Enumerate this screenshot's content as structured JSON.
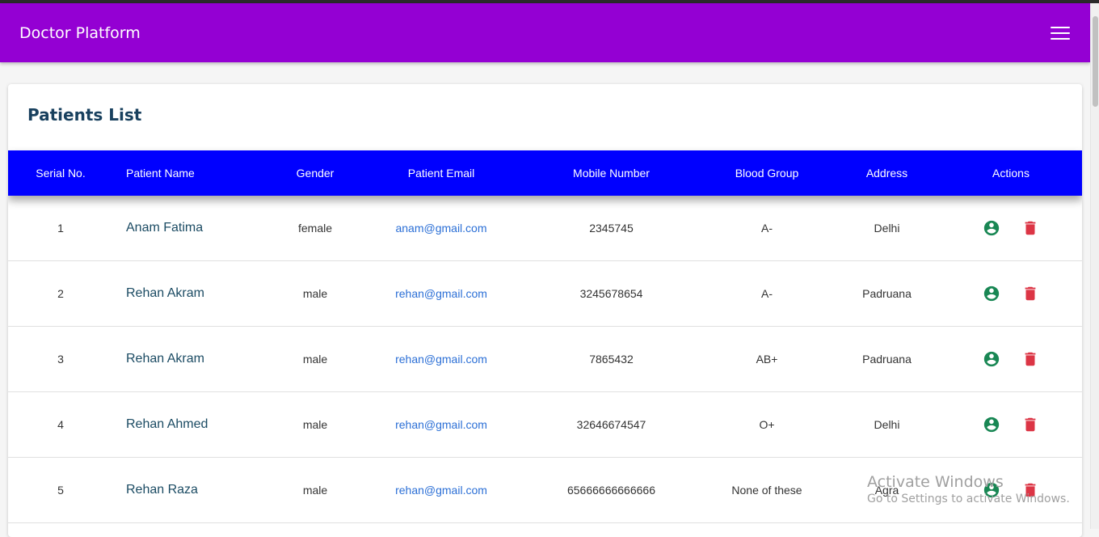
{
  "app": {
    "title": "Doctor Platform",
    "menu_icon": "menu-icon"
  },
  "page": {
    "title": "Patients List"
  },
  "table": {
    "headers": [
      "Serial No.",
      "Patient Name",
      "Gender",
      "Patient Email",
      "Mobile Number",
      "Blood Group",
      "Address",
      "Actions"
    ],
    "rows": [
      {
        "serial": "1",
        "name": "Anam Fatima",
        "gender": "female",
        "email": "anam@gmail.com",
        "mobile": "2345745",
        "blood": "A-",
        "address": "Delhi"
      },
      {
        "serial": "2",
        "name": "Rehan Akram",
        "gender": "male",
        "email": "rehan@gmail.com",
        "mobile": "3245678654",
        "blood": "A-",
        "address": "Padruana"
      },
      {
        "serial": "3",
        "name": "Rehan Akram",
        "gender": "male",
        "email": "rehan@gmail.com",
        "mobile": "7865432",
        "blood": "AB+",
        "address": "Padruana"
      },
      {
        "serial": "4",
        "name": "Rehan Ahmed",
        "gender": "male",
        "email": "rehan@gmail.com",
        "mobile": "32646674547",
        "blood": "O+",
        "address": "Delhi"
      },
      {
        "serial": "5",
        "name": "Rehan Raza",
        "gender": "male",
        "email": "rehan@gmail.com",
        "mobile": "65666666666666",
        "blood": "None of these",
        "address": "Agra"
      }
    ],
    "action_icons": [
      "account-circle-icon",
      "trash-icon"
    ]
  },
  "watermark": {
    "title": "Activate Windows",
    "subtitle": "Go to Settings to activate Windows."
  },
  "colors": {
    "appbar": "#9400d3",
    "table_header": "#0000ff",
    "profile_icon": "#198754",
    "delete_icon": "#dc3545",
    "link": "#2b6fd6"
  }
}
